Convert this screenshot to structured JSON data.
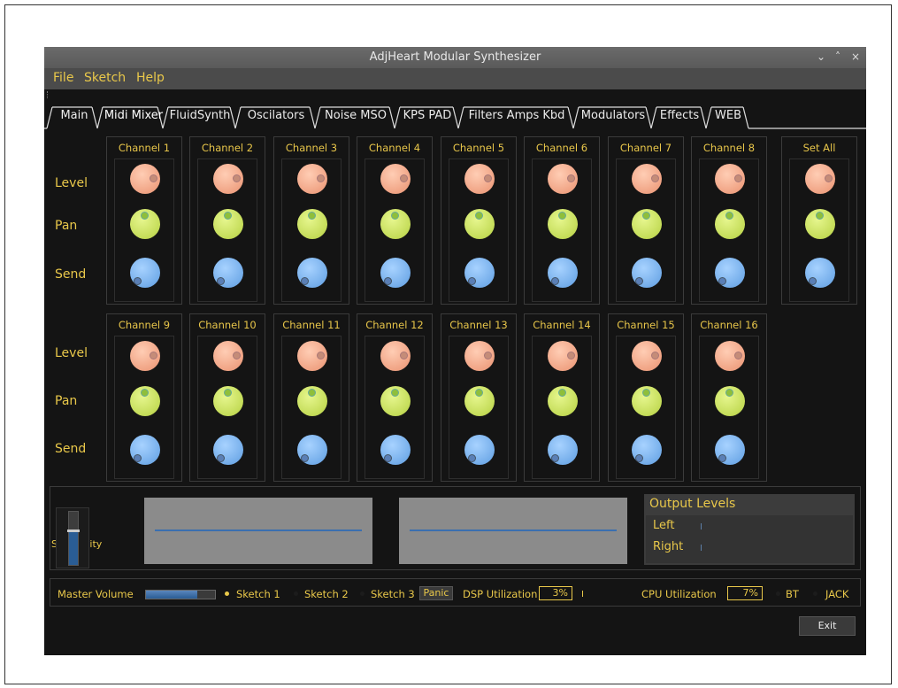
{
  "window": {
    "title": "AdjHeart Modular Synthesizer",
    "controls": [
      "⌄",
      "˄",
      "×"
    ]
  },
  "menu": [
    "File",
    "Sketch",
    "Help"
  ],
  "tabs": [
    "Main",
    "Midi Mixer",
    "FluidSynth",
    "Oscilators",
    "Noise MSO",
    "KPS PAD",
    "Filters Amps Kbd",
    "Modulators",
    "Effects",
    "WEB"
  ],
  "row_labels": {
    "level": "Level",
    "pan": "Pan",
    "send": "Send"
  },
  "channels_row1": [
    "Channel 1",
    "Channel 2",
    "Channel 3",
    "Channel 4",
    "Channel 5",
    "Channel 6",
    "Channel 7",
    "Channel 8"
  ],
  "channels_row2": [
    "Channel 9",
    "Channel 10",
    "Channel 11",
    "Channel 12",
    "Channel 13",
    "Channel 14",
    "Channel 15",
    "Channel 16"
  ],
  "set_all": "Set All",
  "sensitivity": {
    "label": "Sensitivity"
  },
  "output_levels": {
    "title": "Output Levels",
    "left": "Left",
    "right": "Right"
  },
  "bottom": {
    "master_volume": "Master Volume",
    "sketch1": "Sketch 1",
    "sketch2": "Sketch 2",
    "sketch3": "Sketch 3",
    "selected_sketch": "Sketch 1",
    "panic": "Panic",
    "dsp_label": "DSP Utilization",
    "dsp_value": "3%",
    "cpu_label": "CPU Utilization",
    "cpu_value": "7%",
    "bt": "BT",
    "jack": "JACK"
  },
  "exit": "Exit",
  "colors": {
    "accent": "#e9c84a",
    "level_knob": "#f0a384",
    "pan_knob": "#c4dc58",
    "send_knob": "#74adea",
    "background": "#141414"
  }
}
